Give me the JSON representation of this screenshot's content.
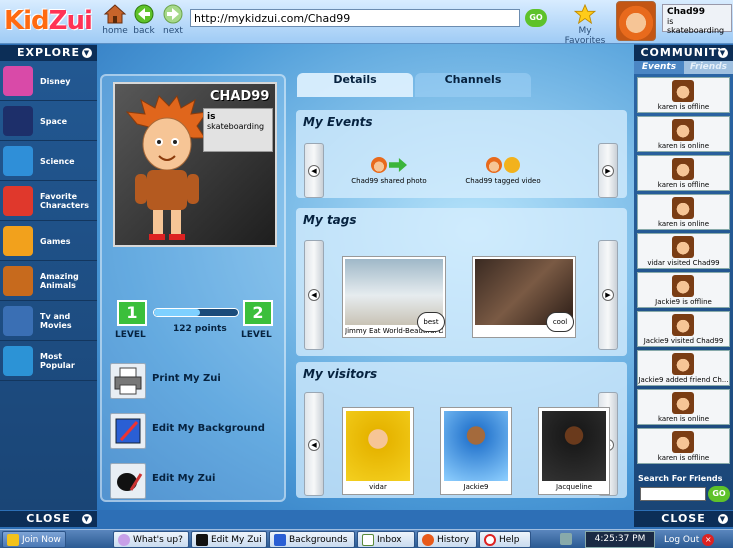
{
  "header": {
    "logo_main": "Kid",
    "logo_accent": "Zui",
    "home_label": "home",
    "back_label": "back",
    "next_label": "next",
    "address": "http://mykidzui.com/Chad99",
    "go_label": "GO",
    "favorites_label": "My Favorites",
    "user_name": "Chad99",
    "user_status": "is skateboarding"
  },
  "explore": {
    "title": "EXPLORE",
    "close": "CLOSE",
    "items": [
      {
        "label": "Disney",
        "color": "#d94aa8"
      },
      {
        "label": "Space",
        "color": "#1d2f6a"
      },
      {
        "label": "Science",
        "color": "#2f8fd8"
      },
      {
        "label": "Favorite Characters",
        "color": "#e0382c"
      },
      {
        "label": "Games",
        "color": "#f2a11c"
      },
      {
        "label": "Amazing Animals",
        "color": "#c76a1d"
      },
      {
        "label": "Tv and Movies",
        "color": "#3a6fb4"
      },
      {
        "label": "Most Popular",
        "color": "#2c93d6"
      }
    ]
  },
  "profile": {
    "name": "CHAD99",
    "status_prefix": "is",
    "status": "skateboarding",
    "level_left": "1",
    "level_right": "2",
    "level_word": "LEVEL",
    "points": "122 points",
    "progress": 0.55,
    "actions": [
      "Print My Zui",
      "Edit My Background",
      "Edit My Zui"
    ]
  },
  "tabs": [
    "Details",
    "Channels"
  ],
  "events": {
    "title": "My Events",
    "items": [
      "Chad99 shared photo",
      "Chad99 tagged video"
    ]
  },
  "tags": {
    "title": "My tags",
    "items": [
      {
        "caption": "Jimmy Eat World-Beautiful Da",
        "bubble": "best"
      },
      {
        "caption": "",
        "bubble": "cool"
      }
    ]
  },
  "visitors": {
    "title": "My visitors",
    "items": [
      "vidar",
      "Jackie9",
      "Jacqueline"
    ]
  },
  "community": {
    "title": "COMMUNITY",
    "tab_events": "Events",
    "tab_friends": "Friends",
    "close": "CLOSE",
    "search_label": "Search For Friends",
    "search_go": "GO",
    "items": [
      "karen is offline",
      "karen is online",
      "karen is offline",
      "karen is online",
      "vidar visited Chad99",
      "Jackie9 is offline",
      "Jackie9 visited Chad99",
      "Jackie9 added friend Ch...",
      "karen is online",
      "karen is offline"
    ]
  },
  "taskbar": {
    "join": "Join Now",
    "whatsup": "What's up?",
    "editzui": "Edit My Zui",
    "backgrounds": "Backgrounds",
    "inbox": "Inbox",
    "history": "History",
    "help": "Help",
    "time": "4:25:37 PM",
    "logout": "Log Out"
  }
}
